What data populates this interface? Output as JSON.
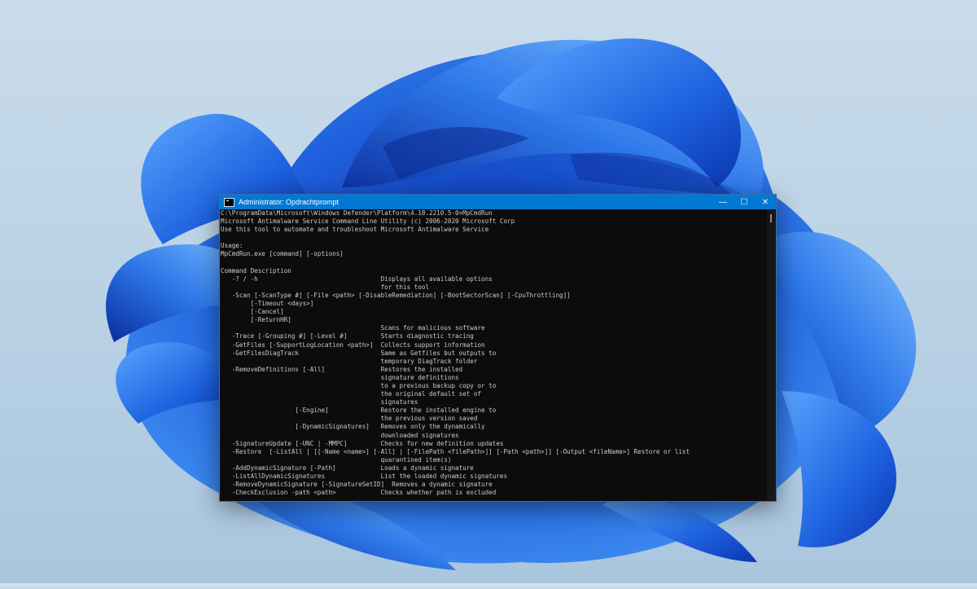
{
  "window": {
    "title": "Administrator: Opdrachtprompt",
    "minimize_glyph": "—",
    "maximize_glyph": "☐",
    "close_glyph": "✕"
  },
  "icons": {
    "app": "cmd-icon"
  },
  "colors": {
    "titlebar": "#0078d4",
    "console_bg": "#0c0c0c",
    "console_text": "#cccccc",
    "wallpaper_accent": "#1e5fdc"
  },
  "console": {
    "lines": [
      "C:\\ProgramData\\Microsoft\\Windows Defender\\Platform\\4.18.2210.5-0>MpCmdRun",
      "Microsoft Antimalware Service Command Line Utility (c) 2006-2020 Microsoft Corp",
      "Use this tool to automate and troubleshoot Microsoft Antimalware Service",
      "",
      "Usage:",
      "MpCmdRun.exe [command] [-options]",
      "",
      "Command Description",
      "   -? / -h                                 Displays all available options",
      "                                           for this tool",
      "   -Scan [-ScanType #] [-File <path> [-DisableRemediation] [-BootSectorScan] [-CpuThrottling]]",
      "        [-Timeout <days>]",
      "        [-Cancel]",
      "        [-ReturnHR]",
      "                                           Scans for malicious software",
      "   -Trace [-Grouping #] [-Level #]         Starts diagnostic tracing",
      "   -GetFiles [-SupportLogLocation <path>]  Collects support information",
      "   -GetFilesDiagTrack                      Same as Getfiles but outputs to",
      "                                           temporary DiagTrack folder",
      "   -RemoveDefinitions [-All]               Restores the installed",
      "                                           signature definitions",
      "                                           to a previous backup copy or to",
      "                                           the original default set of",
      "                                           signatures",
      "                    [-Engine]              Restore the installed engine to",
      "                                           the previous version saved",
      "                    [-DynamicSignatures]   Removes only the dynamically",
      "                                           downloaded signatures",
      "   -SignatureUpdate [-UNC | -MMPC]         Checks for new definition updates",
      "   -Restore  [-ListAll | [[-Name <name>] [-All] | [-FilePath <filePath>]] [-Path <path>]] [-Output <fileName>] Restore or list",
      "                                           quarantined item(s)",
      "   -AddDynamicSignature [-Path]            Loads a dynamic signature",
      "   -ListAllDynamicSignatures               List the loaded dynamic signatures",
      "   -RemoveDynamicSignature [-SignatureSetID]  Removes a dynamic signature",
      "   -CheckExclusion -path <path>            Checks whether path is excluded"
    ]
  }
}
